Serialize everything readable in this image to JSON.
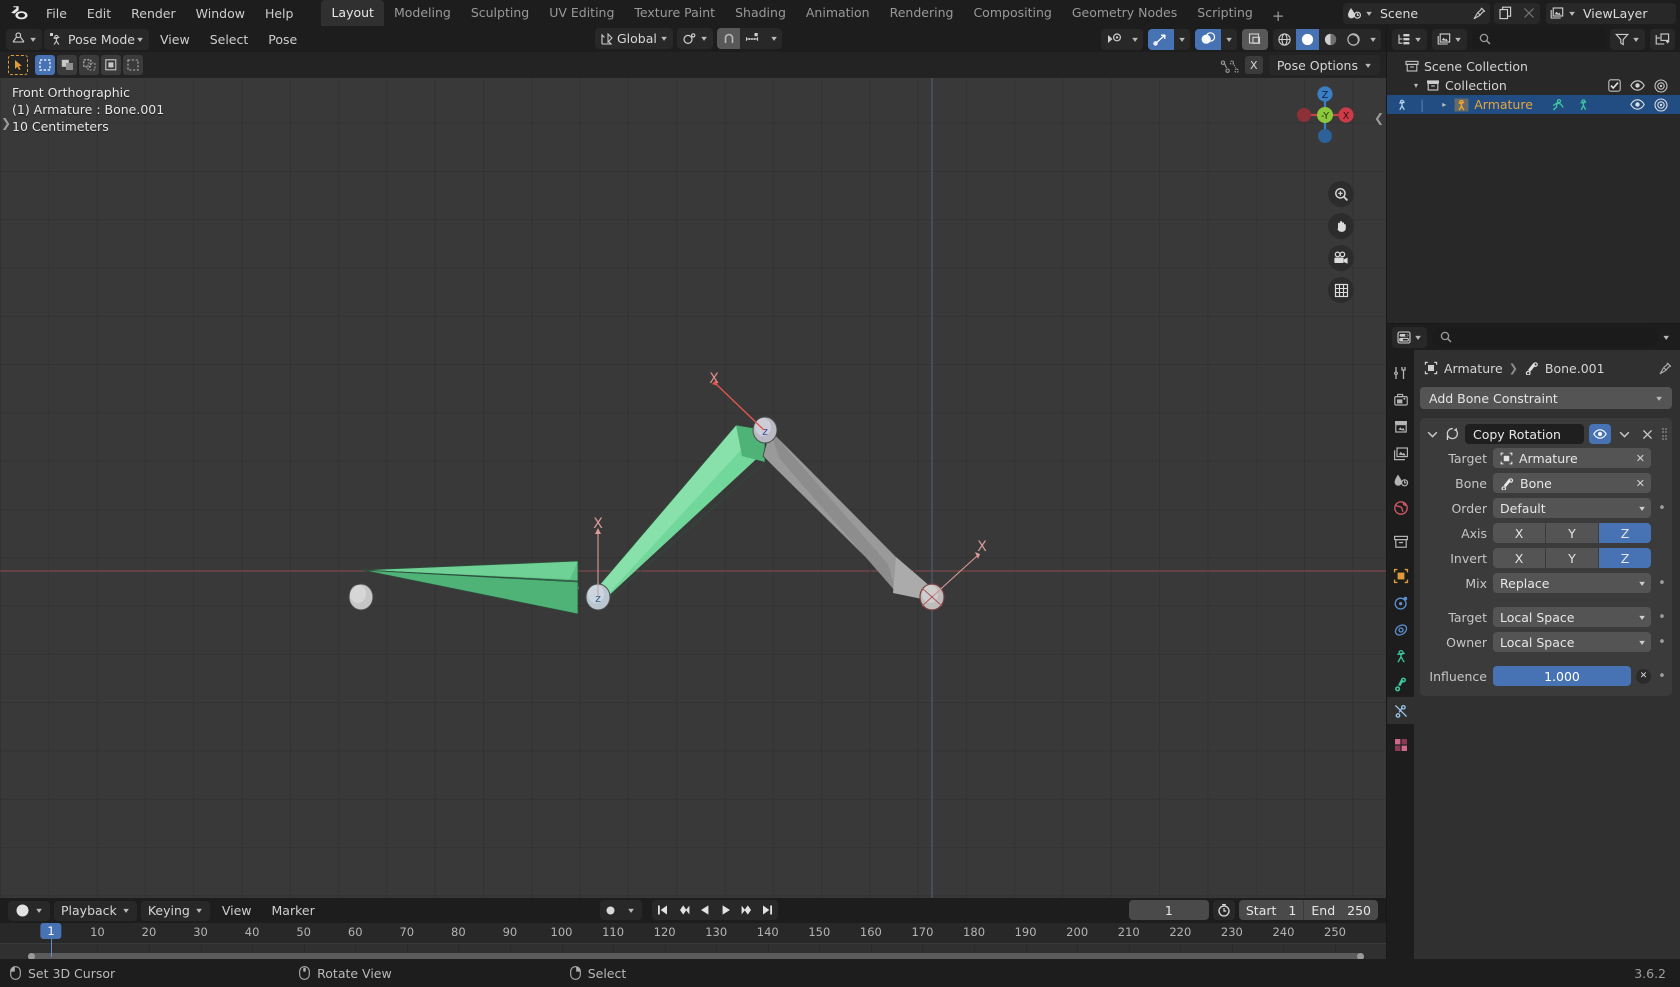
{
  "app": {
    "name": "Blender",
    "version": "3.6.2",
    "accent_blue": "#4772b3",
    "accent_orange": "#e09b3a"
  },
  "topbar": {
    "menus": [
      "File",
      "Edit",
      "Render",
      "Window",
      "Help"
    ],
    "workspaces": [
      {
        "label": "Layout",
        "active": true
      },
      {
        "label": "Modeling",
        "active": false
      },
      {
        "label": "Sculpting",
        "active": false
      },
      {
        "label": "UV Editing",
        "active": false
      },
      {
        "label": "Texture Paint",
        "active": false
      },
      {
        "label": "Shading",
        "active": false
      },
      {
        "label": "Animation",
        "active": false
      },
      {
        "label": "Rendering",
        "active": false
      },
      {
        "label": "Compositing",
        "active": false
      },
      {
        "label": "Geometry Nodes",
        "active": false
      },
      {
        "label": "Scripting",
        "active": false
      }
    ],
    "add_workspace": "+",
    "scene_name": "Scene",
    "view_layer_name": "ViewLayer"
  },
  "viewport": {
    "mode": "Pose Mode",
    "menus": [
      "View",
      "Select",
      "Pose"
    ],
    "transform_orientation": "Global",
    "pose_options": "Pose Options",
    "x_axis_badge": "X",
    "info_lines": [
      "Front Orthographic",
      "(1) Armature : Bone.001",
      "10 Centimeters"
    ],
    "gizmo_axes": {
      "z": "Z",
      "y": "-Y",
      "x": "X"
    },
    "side_buttons": [
      "zoom-icon",
      "hand-icon",
      "camera-icon",
      "grid-icon"
    ]
  },
  "timeline": {
    "menus": [
      "Playback",
      "Keying",
      "View",
      "Marker"
    ],
    "current_frame": "1",
    "start_label": "Start",
    "start_value": "1",
    "end_label": "End",
    "end_value": "250",
    "playhead_frame": "1",
    "ticks": [
      "1",
      "10",
      "20",
      "30",
      "40",
      "50",
      "60",
      "70",
      "80",
      "90",
      "100",
      "110",
      "120",
      "130",
      "140",
      "150",
      "160",
      "170",
      "180",
      "190",
      "200",
      "210",
      "220",
      "230",
      "240",
      "250"
    ]
  },
  "statusbar": {
    "items": [
      {
        "icon": "mouse-left-icon",
        "label": "Set 3D Cursor"
      },
      {
        "icon": "mouse-middle-icon",
        "label": "Rotate View"
      },
      {
        "icon": "mouse-right-icon",
        "label": "Select"
      }
    ],
    "version": "3.6.2"
  },
  "outliner": {
    "search_placeholder": "",
    "rows": [
      {
        "label": "Scene Collection",
        "icon": "collection-icon",
        "indent": 14,
        "disclosure": "",
        "selected": false,
        "checkbox": false,
        "eye": false,
        "camera": false
      },
      {
        "label": "Collection",
        "icon": "collection-icon",
        "indent": 24,
        "disclosure": "▾",
        "selected": false,
        "checkbox": true,
        "eye": true,
        "camera": true
      },
      {
        "label": "Armature",
        "icon": "armature-icon",
        "indent": 44,
        "disclosure": "▸",
        "selected": true,
        "checkbox": false,
        "eye": true,
        "camera": true
      }
    ]
  },
  "properties": {
    "breadcrumb": [
      {
        "label": "Armature",
        "icon": "object-icon"
      },
      {
        "label": "Bone.001",
        "icon": "bone-icon"
      }
    ],
    "add_constraint_label": "Add Bone Constraint",
    "constraint": {
      "name": "Copy Rotation",
      "icon": "copy-rotation-icon",
      "rows": [
        {
          "label": "Target",
          "type": "pointer",
          "value": "Armature",
          "icon": "object-icon",
          "clear": "✕"
        },
        {
          "label": "Bone",
          "type": "pointer",
          "value": "Bone",
          "icon": "bone-icon",
          "clear": "✕"
        },
        {
          "label": "Order",
          "type": "dropdown",
          "value": "Default",
          "animdot": true
        },
        {
          "label": "Axis",
          "type": "segments",
          "options": [
            "X",
            "Y",
            "Z"
          ],
          "enabled": [
            false,
            false,
            true
          ],
          "animdot": false
        },
        {
          "label": "Invert",
          "type": "segments",
          "options": [
            "X",
            "Y",
            "Z"
          ],
          "enabled": [
            false,
            false,
            true
          ],
          "animdot": false
        },
        {
          "label": "Mix",
          "type": "dropdown",
          "value": "Replace",
          "animdot": true
        }
      ],
      "space_rows": [
        {
          "label": "Target",
          "type": "dropdown",
          "value": "Local Space",
          "animdot": true
        },
        {
          "label": "Owner",
          "type": "dropdown",
          "value": "Local Space",
          "animdot": true
        }
      ],
      "influence": {
        "label": "Influence",
        "value": "1.000",
        "fill_pct": 100
      }
    }
  }
}
